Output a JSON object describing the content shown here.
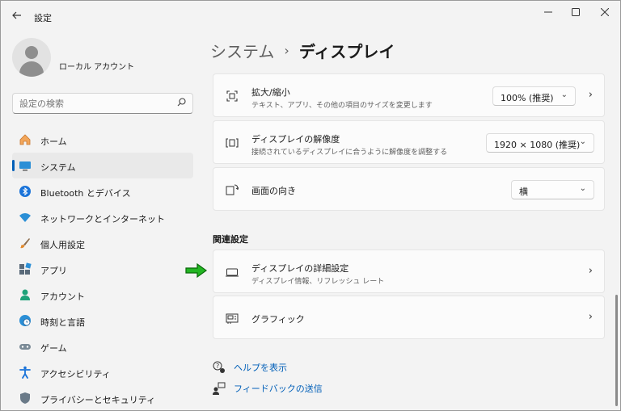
{
  "window": {
    "title": "設定",
    "back_icon": "arrow-left-icon",
    "minimize_glyph": "—",
    "maximize_glyph": "☐",
    "close_glyph": "✕"
  },
  "profile": {
    "name": "ローカル アカウント"
  },
  "search": {
    "placeholder": "設定の検索",
    "icon_glyph": "⚲"
  },
  "sidebar": {
    "items": [
      {
        "label": "ホーム",
        "icon": "home-icon",
        "active": false
      },
      {
        "label": "システム",
        "icon": "system-icon",
        "active": true
      },
      {
        "label": "Bluetooth とデバイス",
        "icon": "bluetooth-icon",
        "active": false
      },
      {
        "label": "ネットワークとインターネット",
        "icon": "wifi-icon",
        "active": false
      },
      {
        "label": "個人用設定",
        "icon": "brush-icon",
        "active": false
      },
      {
        "label": "アプリ",
        "icon": "apps-icon",
        "active": false
      },
      {
        "label": "アカウント",
        "icon": "account-icon",
        "active": false
      },
      {
        "label": "時刻と言語",
        "icon": "globe-clock-icon",
        "active": false
      },
      {
        "label": "ゲーム",
        "icon": "gamepad-icon",
        "active": false
      },
      {
        "label": "アクセシビリティ",
        "icon": "accessibility-icon",
        "active": false
      },
      {
        "label": "プライバシーとセキュリティ",
        "icon": "shield-icon",
        "active": false
      }
    ]
  },
  "breadcrumb": {
    "parent": "システム",
    "separator": "›",
    "current": "ディスプレイ"
  },
  "main": {
    "scale": {
      "title": "拡大/縮小",
      "subtitle": "テキスト、アプリ、その他の項目のサイズを変更します",
      "value": "100% (推奨)"
    },
    "resolution": {
      "title": "ディスプレイの解像度",
      "subtitle": "接続されているディスプレイに合うように解像度を調整する",
      "value": "1920 × 1080 (推奨)"
    },
    "orientation": {
      "title": "画面の向き",
      "value": "横"
    },
    "related_title": "関連設定",
    "advanced": {
      "title": "ディスプレイの詳細設定",
      "subtitle": "ディスプレイ情報、リフレッシュ レート"
    },
    "graphics": {
      "title": "グラフィック"
    },
    "links": {
      "help": "ヘルプを表示",
      "feedback": "フィードバックの送信"
    }
  },
  "colors": {
    "accent": "#005fb8",
    "annotation_arrow": "#22b522",
    "background": "#f3f3f3",
    "card": "#fbfbfb"
  }
}
